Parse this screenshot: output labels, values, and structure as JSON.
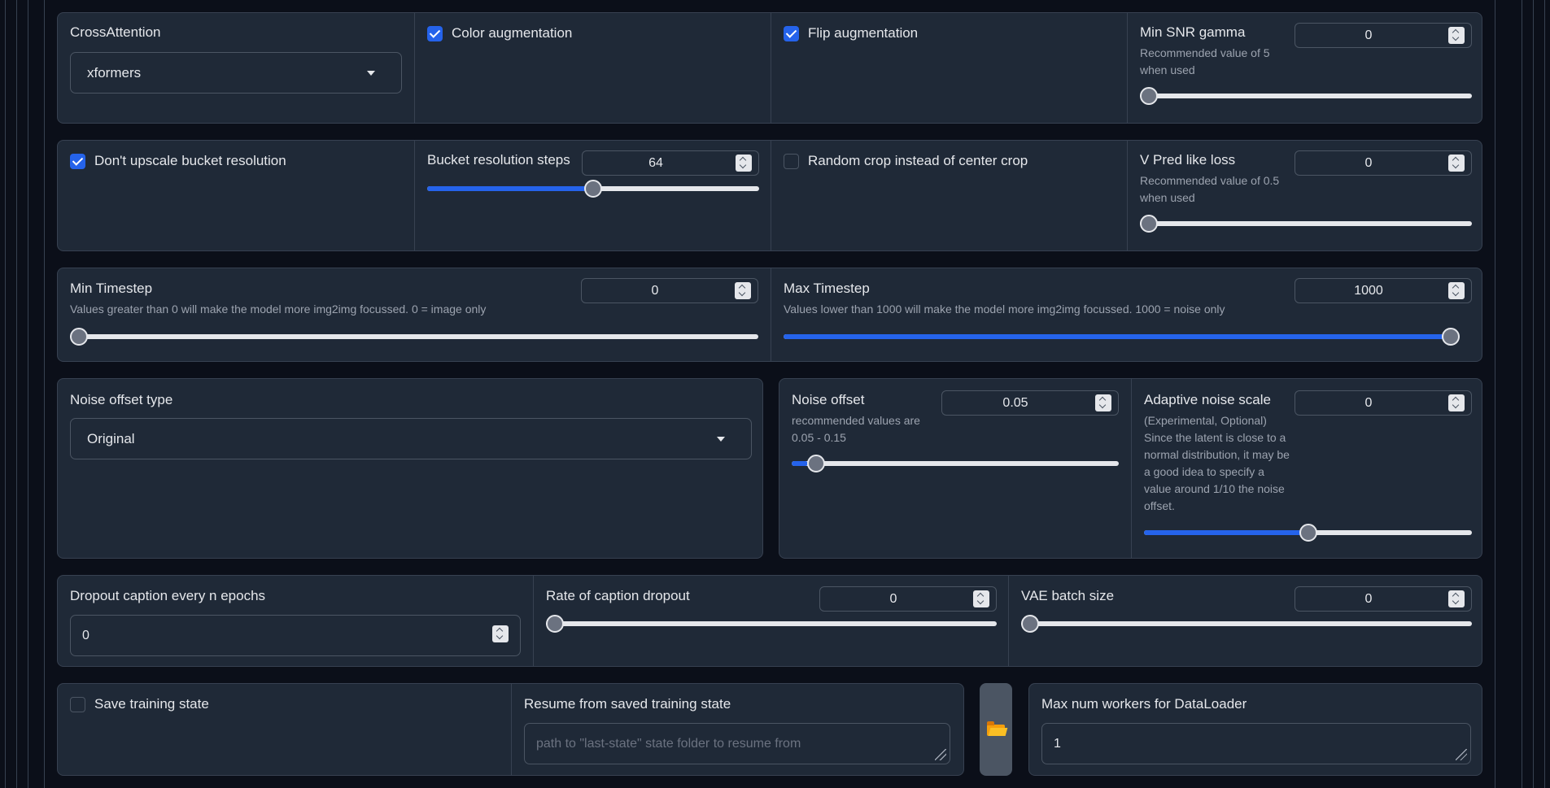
{
  "cross_attention": {
    "label": "CrossAttention",
    "value": "xformers"
  },
  "color_augmentation": {
    "label": "Color augmentation",
    "checked": true
  },
  "flip_augmentation": {
    "label": "Flip augmentation",
    "checked": true
  },
  "min_snr_gamma": {
    "label": "Min SNR gamma",
    "hint": "Recommended value of 5 when used",
    "value": "0",
    "fraction": 0.0
  },
  "dont_upscale": {
    "label": "Don't upscale bucket resolution",
    "checked": true
  },
  "bucket_steps": {
    "label": "Bucket resolution steps",
    "value": "64",
    "fraction": 0.5
  },
  "random_crop": {
    "label": "Random crop instead of center crop",
    "checked": false
  },
  "v_pred": {
    "label": "V Pred like loss",
    "hint": "Recommended value of 0.5 when used",
    "value": "0",
    "fraction": 0.0
  },
  "min_timestep": {
    "label": "Min Timestep",
    "hint": "Values greater than 0 will make the model more img2img focussed. 0 = image only",
    "value": "0",
    "fraction": 0.0
  },
  "max_timestep": {
    "label": "Max Timestep",
    "hint": "Values lower than 1000 will make the model more img2img focussed. 1000 = noise only",
    "value": "1000",
    "fraction": 1.0
  },
  "noise_offset_type": {
    "label": "Noise offset type",
    "value": "Original"
  },
  "noise_offset": {
    "label": "Noise offset",
    "hint": "recommended values are 0.05 - 0.15",
    "value": "0.05",
    "fraction": 0.05
  },
  "adaptive_noise": {
    "label": "Adaptive noise scale",
    "hint": "(Experimental, Optional) Since the latent is close to a normal distribution, it may be a good idea to specify a value around 1/10 the noise offset.",
    "value": "0",
    "fraction": 0.5
  },
  "dropout_every": {
    "label": "Dropout caption every n epochs",
    "value": "0"
  },
  "caption_dropout_rate": {
    "label": "Rate of caption dropout",
    "value": "0",
    "fraction": 0.0
  },
  "vae_batch": {
    "label": "VAE batch size",
    "value": "0",
    "fraction": 0.0
  },
  "save_state": {
    "label": "Save training state",
    "checked": false
  },
  "resume_state": {
    "label": "Resume from saved training state",
    "placeholder": "path to \"last-state\" state folder to resume from"
  },
  "max_workers": {
    "label": "Max num workers for DataLoader",
    "value": "1"
  },
  "colors": {
    "accent": "#2563eb",
    "panel": "#1f2937",
    "border": "#374151",
    "background": "#0b0f19"
  },
  "icons": {
    "folder_button": "folder-open-icon"
  }
}
